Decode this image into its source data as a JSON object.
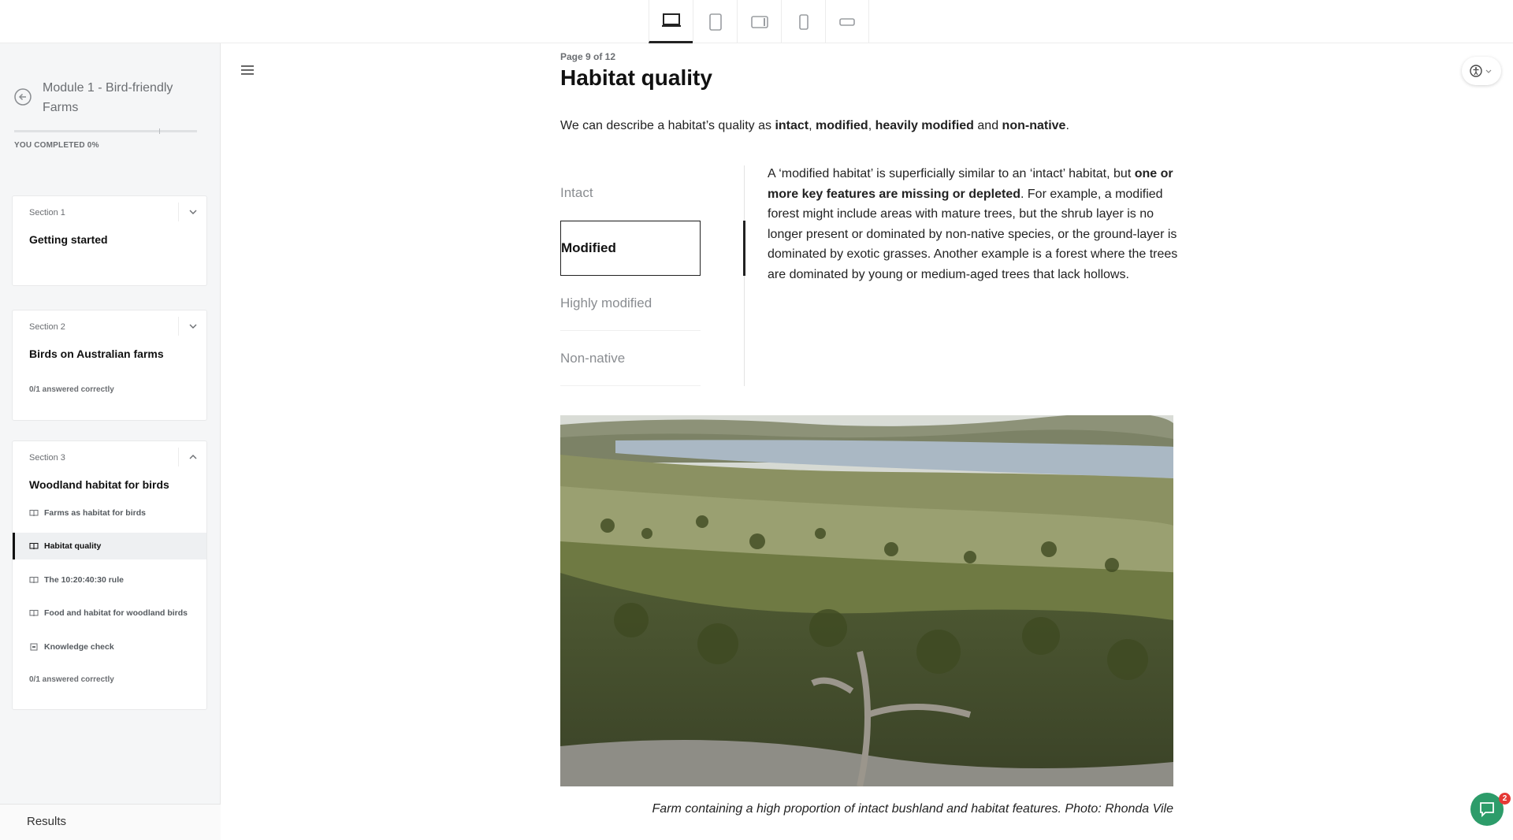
{
  "devices": [
    {
      "name": "desktop",
      "active": true
    },
    {
      "name": "tablet-portrait",
      "active": false
    },
    {
      "name": "tablet-landscape",
      "active": false
    },
    {
      "name": "phone-portrait",
      "active": false
    },
    {
      "name": "phone-landscape",
      "active": false
    }
  ],
  "sidebar": {
    "module_title": "Module 1 - Bird-friendly Farms",
    "progress_percent": 0,
    "completed_label": "YOU COMPLETED 0%",
    "sections": [
      {
        "label": "Section 1",
        "title": "Getting started",
        "status": ""
      },
      {
        "label": "Section 2",
        "title": "Birds on Australian farms",
        "status": "0/1 answered correctly"
      },
      {
        "label": "Section 3",
        "title": "Woodland habitat for birds",
        "lessons": [
          {
            "label": "Farms as habitat for birds",
            "icon": "book-icon"
          },
          {
            "label": "Habitat quality",
            "icon": "book-icon",
            "active": true
          },
          {
            "label": "The 10:20:40:30 rule",
            "icon": "book-icon"
          },
          {
            "label": "Food and habitat for woodland birds",
            "icon": "book-icon"
          },
          {
            "label": "Knowledge check",
            "icon": "quiz-icon"
          }
        ],
        "status": "0/1 answered correctly"
      }
    ],
    "results_label": "Results"
  },
  "main": {
    "page_number": "Page 9 of 12",
    "title": "Habitat quality",
    "intro": {
      "prefix": "We can describe a habitat’s quality as ",
      "t1": "intact",
      "sep1": ", ",
      "t2": "modified",
      "sep2": ", ",
      "t3": "heavily modified",
      "sep3": " and ",
      "t4": "non-native",
      "suffix": "."
    },
    "tabs": [
      "Intact",
      "Modified",
      "Highly modified",
      "Non-native"
    ],
    "active_tab": 1,
    "tab_content": {
      "p1": "A ‘modified habitat’ is superficially similar to an ‘intact’ habitat, but ",
      "bold": "one or more key features are missing or depleted",
      "p2": ". For example, a modified forest might include areas with mature trees, but the shrub layer is no longer present or dominated by non-native species, or the ground-layer is dominated by exotic grasses. Another example is a forest where the trees are dominated by young or medium-aged trees that lack hollows."
    },
    "caption": "Farm containing a high proportion of intact bushland and habitat features. Photo: Rhonda Vile"
  },
  "chat": {
    "badge": "2"
  },
  "colors": {
    "accent": "#222222",
    "chat": "#2d9c6a",
    "badge": "#e53935"
  }
}
